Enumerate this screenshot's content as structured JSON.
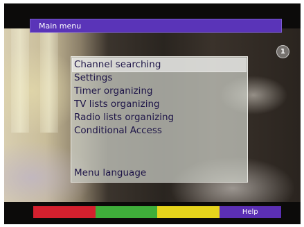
{
  "header": {
    "title": "Main menu"
  },
  "channel_logo": {
    "glyph": "1",
    "icon": "channel-logo-icon"
  },
  "menu": {
    "items": [
      {
        "label": "Channel searching",
        "selected": true
      },
      {
        "label": "Settings",
        "selected": false
      },
      {
        "label": "Timer organizing",
        "selected": false
      },
      {
        "label": "TV lists organizing",
        "selected": false
      },
      {
        "label": "Radio lists organizing",
        "selected": false
      },
      {
        "label": "Conditional Access",
        "selected": false
      }
    ],
    "bottom_item": {
      "label": "Menu language"
    }
  },
  "footer": {
    "keys": [
      {
        "color": "#d4202e",
        "label": ""
      },
      {
        "color": "#3fae3a",
        "label": ""
      },
      {
        "color": "#e6d41c",
        "label": ""
      },
      {
        "color": "#5b2fb3",
        "label": "Help"
      }
    ]
  },
  "colors": {
    "header_bg": "#5a34b8",
    "menu_text": "#1e1548"
  }
}
